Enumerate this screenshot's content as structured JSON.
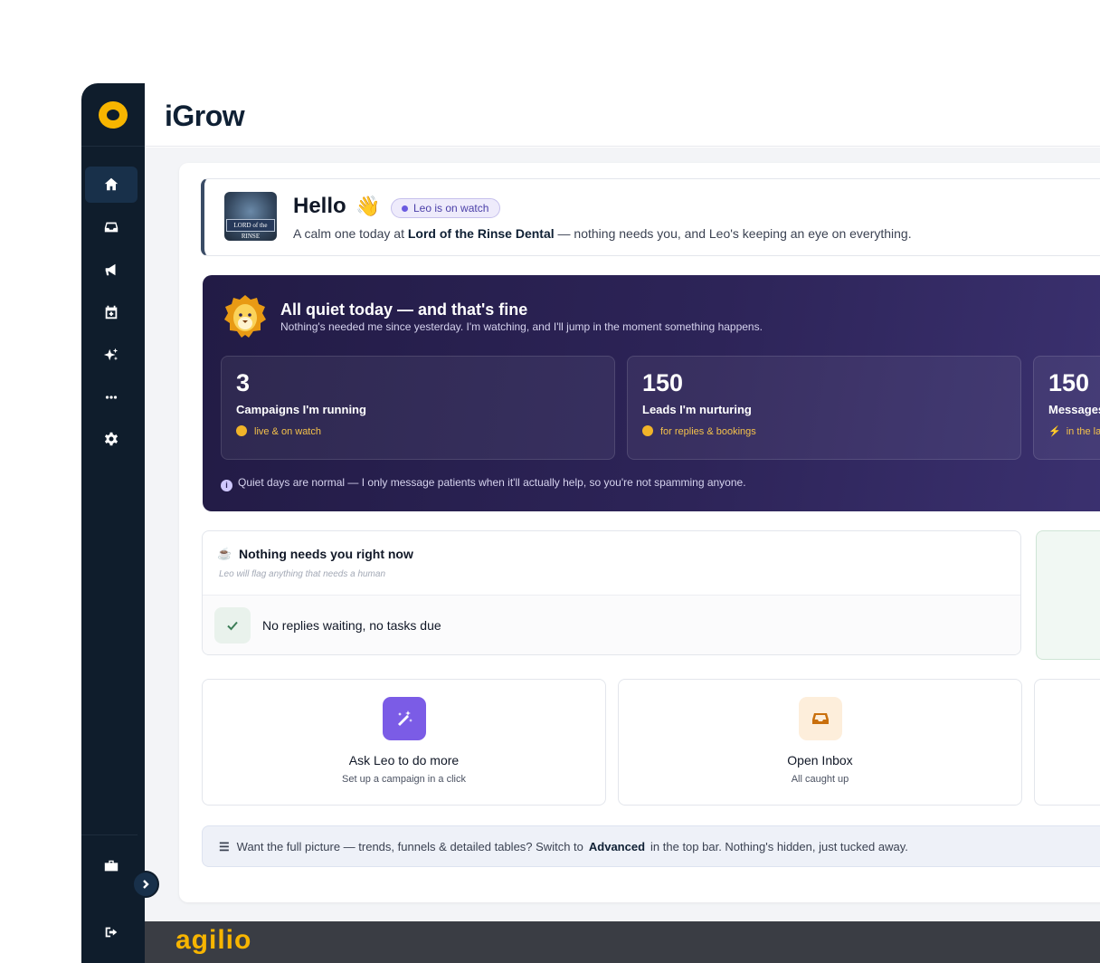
{
  "app": {
    "title": "iGrow"
  },
  "sidebar": {
    "items": [
      {
        "name": "home",
        "active": true
      },
      {
        "name": "inbox",
        "active": false
      },
      {
        "name": "campaigns",
        "active": false
      },
      {
        "name": "calendar",
        "active": false
      },
      {
        "name": "magic",
        "active": false
      },
      {
        "name": "more",
        "active": false
      },
      {
        "name": "settings",
        "active": false
      },
      {
        "name": "briefcase",
        "active": false
      },
      {
        "name": "logout",
        "active": false
      }
    ]
  },
  "hello": {
    "title": "Hello",
    "emoji": "👋",
    "status_pill": "Leo is on watch",
    "avatar_text": "LORD of the RINSE",
    "sub_prefix": "A calm one today at ",
    "practice_name": "Lord of the Rinse Dental",
    "sub_suffix": " — nothing needs you, and Leo's keeping an eye on everything."
  },
  "hero": {
    "title": "All quiet today — and that's fine",
    "subtitle": "Nothing's needed me since yesterday. I'm watching, and I'll jump in the moment something happens.",
    "stats": [
      {
        "value": "3",
        "label": "Campaigns I'm running",
        "meta": "live & on watch"
      },
      {
        "value": "150",
        "label": "Leads I'm nurturing",
        "meta": "for replies & bookings"
      },
      {
        "value": "150",
        "label": "Messages",
        "meta": "in the la"
      }
    ],
    "note": "Quiet days are normal — I only message patients when it'll actually help, so you're not spamming anyone."
  },
  "needs": {
    "icon": "☕",
    "title": "Nothing needs you right now",
    "subtitle": "Leo will flag anything that needs a human",
    "status": "No replies waiting, no tasks due"
  },
  "actions": [
    {
      "title": "Ask Leo to do more",
      "subtitle": "Set up a campaign in a click",
      "icon": "magic-wand-icon",
      "color": "#7b5ce6"
    },
    {
      "title": "Open Inbox",
      "subtitle": "All caught up",
      "icon": "inbox-icon",
      "color": "#fdeedb"
    }
  ],
  "hint": {
    "prefix": "Want the full picture — trends, funnels & detailed tables? Switch to",
    "bold": "Advanced",
    "suffix": "in the top bar. Nothing's hidden, just tucked away."
  },
  "footer": {
    "brand": "agilio"
  },
  "colors": {
    "accent": "#f7b500",
    "sidebar": "#0f1d2c",
    "hero": "#2d2458"
  }
}
